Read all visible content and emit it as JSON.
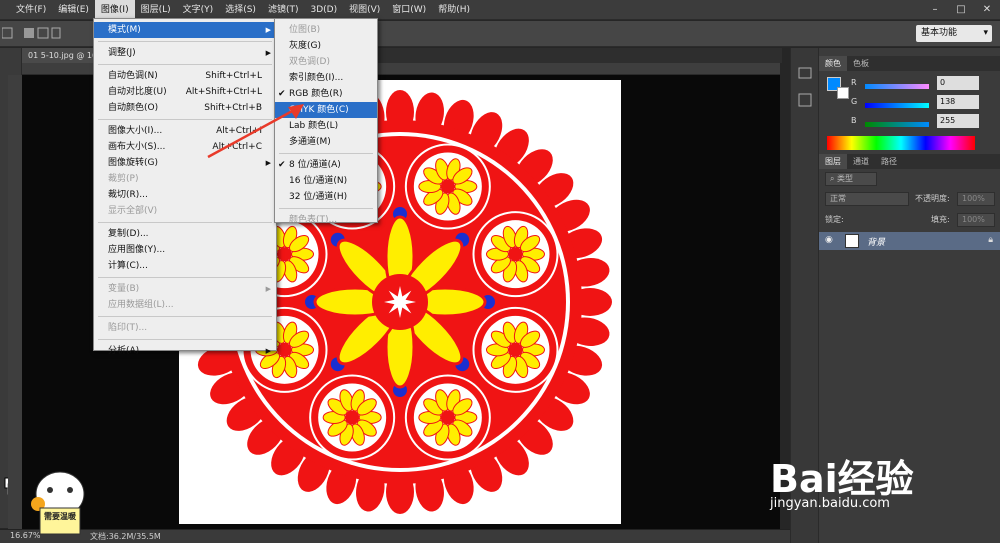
{
  "menubar": {
    "items": [
      "文件(F)",
      "编辑(E)",
      "图像(I)",
      "图层(L)",
      "文字(Y)",
      "选择(S)",
      "滤镜(T)",
      "3D(D)",
      "视图(V)",
      "窗口(W)",
      "帮助(H)"
    ],
    "active_index": 2,
    "window_buttons": [
      "–",
      "□",
      "✕"
    ]
  },
  "options": {
    "workspace": "基本功能"
  },
  "document": {
    "tab": "01 5-10.jpg @ 16..."
  },
  "status": {
    "zoom": "16.67%",
    "doc_info": "文档:36.2M/35.5M"
  },
  "image_menu": {
    "items": [
      {
        "label": "模式(M)",
        "shortcut": "",
        "submenu": true,
        "state": "highlight"
      },
      {
        "sep": true
      },
      {
        "label": "调整(J)",
        "shortcut": "",
        "submenu": true
      },
      {
        "sep": true
      },
      {
        "label": "自动色调(N)",
        "shortcut": "Shift+Ctrl+L"
      },
      {
        "label": "自动对比度(U)",
        "shortcut": "Alt+Shift+Ctrl+L"
      },
      {
        "label": "自动颜色(O)",
        "shortcut": "Shift+Ctrl+B"
      },
      {
        "sep": true
      },
      {
        "label": "图像大小(I)...",
        "shortcut": "Alt+Ctrl+I"
      },
      {
        "label": "画布大小(S)...",
        "shortcut": "Alt+Ctrl+C"
      },
      {
        "label": "图像旋转(G)",
        "shortcut": "",
        "submenu": true
      },
      {
        "label": "裁剪(P)",
        "shortcut": "",
        "state": "disabled"
      },
      {
        "label": "裁切(R)...",
        "shortcut": ""
      },
      {
        "label": "显示全部(V)",
        "shortcut": "",
        "state": "disabled"
      },
      {
        "sep": true
      },
      {
        "label": "复制(D)...",
        "shortcut": ""
      },
      {
        "label": "应用图像(Y)...",
        "shortcut": ""
      },
      {
        "label": "计算(C)...",
        "shortcut": ""
      },
      {
        "sep": true
      },
      {
        "label": "变量(B)",
        "shortcut": "",
        "submenu": true,
        "state": "disabled"
      },
      {
        "label": "应用数据组(L)...",
        "shortcut": "",
        "state": "disabled"
      },
      {
        "sep": true
      },
      {
        "label": "陷印(T)...",
        "shortcut": "",
        "state": "disabled"
      },
      {
        "sep": true
      },
      {
        "label": "分析(A)",
        "shortcut": "",
        "submenu": true
      }
    ]
  },
  "mode_submenu": {
    "items": [
      {
        "label": "位图(B)",
        "state": "disabled"
      },
      {
        "label": "灰度(G)"
      },
      {
        "label": "双色调(D)",
        "state": "disabled"
      },
      {
        "label": "索引颜色(I)..."
      },
      {
        "label": "RGB 颜色(R)",
        "checked": true
      },
      {
        "label": "CMYK 颜色(C)",
        "state": "highlight"
      },
      {
        "label": "Lab 颜色(L)"
      },
      {
        "label": "多通道(M)"
      },
      {
        "sep": true
      },
      {
        "label": "8 位/通道(A)",
        "checked": true
      },
      {
        "label": "16 位/通道(N)"
      },
      {
        "label": "32 位/通道(H)"
      },
      {
        "sep": true
      },
      {
        "label": "颜色表(T)...",
        "state": "disabled"
      }
    ]
  },
  "color_panel": {
    "tabs": [
      "颜色",
      "色板"
    ],
    "r": {
      "label": "R",
      "value": "0"
    },
    "g": {
      "label": "G",
      "value": "138"
    },
    "b": {
      "label": "B",
      "value": "255"
    },
    "foreground": "#008aff"
  },
  "layers_panel": {
    "tabs": [
      "图层",
      "通道",
      "路径"
    ],
    "filter": "类型",
    "blend_mode": "正常",
    "opacity_label": "不透明度:",
    "opacity": "100%",
    "lock_label": "锁定:",
    "fill_label": "填充:",
    "fill": "100%",
    "layer_name": "背景"
  },
  "watermark": {
    "brand": "Bai经验",
    "url": "jingyan.baidu.com",
    "badge": "需要温暖"
  },
  "colors": {
    "mandala_red": "#f01414",
    "mandala_yellow": "#ffee00",
    "mandala_blue": "#1a2fd0",
    "menu_highlight": "#2a6fc8"
  }
}
